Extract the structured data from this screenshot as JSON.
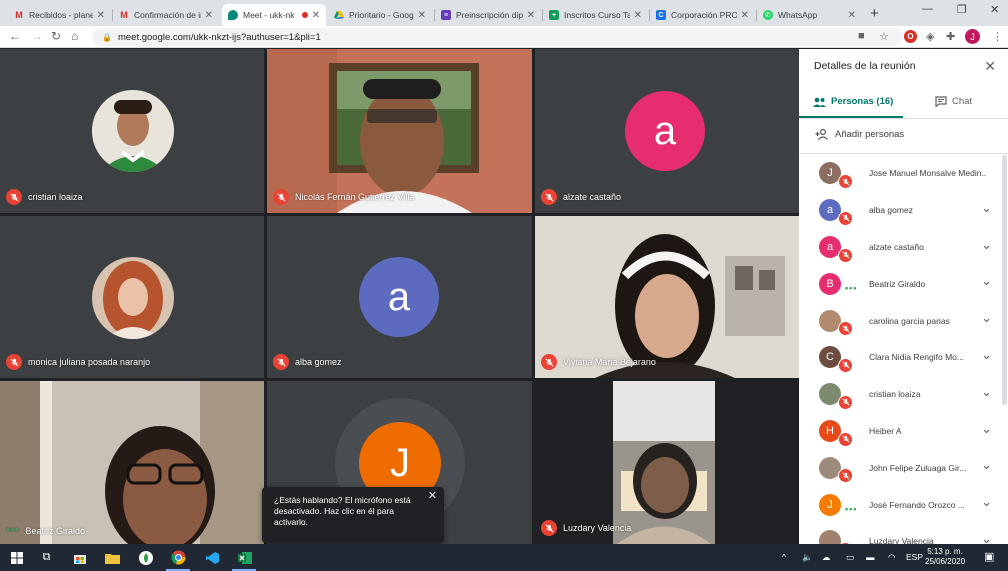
{
  "browser": {
    "tabs": [
      {
        "title": "Recibidos - planea",
        "favicon": "gmail-icon",
        "color": "#d93025"
      },
      {
        "title": "Confirmación de ir",
        "favicon": "gmail-icon",
        "color": "#d93025"
      },
      {
        "title": "Meet - ukk-nk",
        "favicon": "meet-icon",
        "color": "#00897b"
      },
      {
        "title": "Prioritario - Googl",
        "favicon": "drive-icon",
        "color": "#fbbc04"
      },
      {
        "title": "Preinscripción dipl",
        "favicon": "forms-icon",
        "color": "#673ab7"
      },
      {
        "title": "Inscritos Curso Tall",
        "favicon": "sheets-icon",
        "color": "#0f9d58"
      },
      {
        "title": "Corporación PROD",
        "favicon": "site-icon",
        "color": "#1a73e8"
      },
      {
        "title": "WhatsApp",
        "favicon": "whatsapp-icon",
        "color": "#25d366"
      }
    ],
    "url": "meet.google.com/ukk-nkzt-ijs?authuser=1&pli=1",
    "profile_initial": "J"
  },
  "tiles": [
    {
      "name": "cristian loaiza",
      "kind": "photo"
    },
    {
      "name": "Nicolás Fernán Gutierrez Villa",
      "kind": "video"
    },
    {
      "name": "alzate castaño",
      "kind": "initial",
      "initial": "a",
      "color": "#e52d6f"
    },
    {
      "name": "monica juliana posada naranjo",
      "kind": "photo"
    },
    {
      "name": "alba gomez",
      "kind": "initial",
      "initial": "a",
      "color": "#5c6bc0"
    },
    {
      "name": "Viviana Maria Bejarano",
      "kind": "video"
    },
    {
      "name": "Beatriz Giraldo",
      "kind": "video"
    },
    {
      "name": "",
      "kind": "initial",
      "initial": "J",
      "color": "#ef6c00"
    },
    {
      "name": "Luzdary Valencia",
      "kind": "video"
    }
  ],
  "toast": {
    "text": "¿Estás hablando? El micrófono está desactivado. Haz clic en él para activarlo."
  },
  "panel": {
    "title": "Detalles de la reunión",
    "tab_people": "Personas (16)",
    "tab_chat": "Chat",
    "add_people": "Añadir personas",
    "participants": [
      {
        "name": "Jose Manuel Monsalve Medin...",
        "initial": "J",
        "color": "#8d6e63",
        "state": "muted"
      },
      {
        "name": "alba gomez",
        "initial": "a",
        "color": "#5c6bc0",
        "state": "muted"
      },
      {
        "name": "alzate castaño",
        "initial": "a",
        "color": "#e52d6f",
        "state": "muted"
      },
      {
        "name": "Beatriz Giraldo",
        "initial": "B",
        "color": "#e52d6f",
        "state": "speaking"
      },
      {
        "name": "carolina garcia parias",
        "initial": "",
        "color": "#b08b6e",
        "state": "muted"
      },
      {
        "name": "Clara Nidia Rengifo Mo...",
        "initial": "C",
        "color": "#6d4c41",
        "state": "muted"
      },
      {
        "name": "cristian loaiza",
        "initial": "",
        "color": "#7d8a6e",
        "state": "muted"
      },
      {
        "name": "Heiber A",
        "initial": "H",
        "color": "#e64a19",
        "state": "muted"
      },
      {
        "name": "John Felipe Zuluaga Gir...",
        "initial": "",
        "color": "#9e8a7a",
        "state": "muted"
      },
      {
        "name": "José Fernando Orozco ...",
        "initial": "J",
        "color": "#f57c00",
        "state": "speaking"
      },
      {
        "name": "Luzdary Valencia",
        "initial": "",
        "color": "#a08070",
        "state": "muted"
      }
    ]
  },
  "taskbar": {
    "lang": "ESP",
    "time": "5:13 p. m.",
    "date": "25/06/2020"
  }
}
